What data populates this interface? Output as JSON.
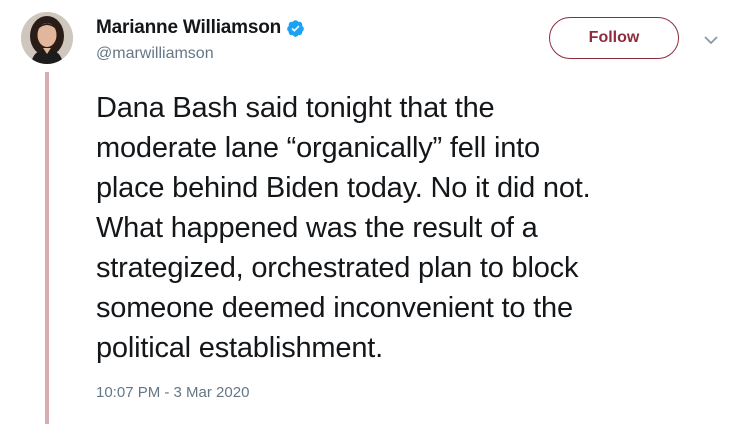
{
  "author": {
    "display_name": "Marianne Williamson",
    "handle": "@marwilliamson",
    "verified": true,
    "avatar_icon": "profile-photo"
  },
  "actions": {
    "follow_label": "Follow",
    "menu_icon": "chevron-down-icon"
  },
  "tweet": {
    "lines": [
      "Dana Bash said tonight that the",
      "moderate lane “organically” fell into",
      "place behind Biden today. No it did not.",
      "What happened was the result of a",
      "strategized, orchestrated plan to block",
      "someone deemed inconvenient to the",
      "political establishment."
    ],
    "timestamp": "10:07 PM - 3 Mar 2020"
  },
  "colors": {
    "accent": "#8e2c3d",
    "thread_line": "#d7adb0",
    "verified_badge": "#1da1f2",
    "secondary_text": "#657786"
  }
}
